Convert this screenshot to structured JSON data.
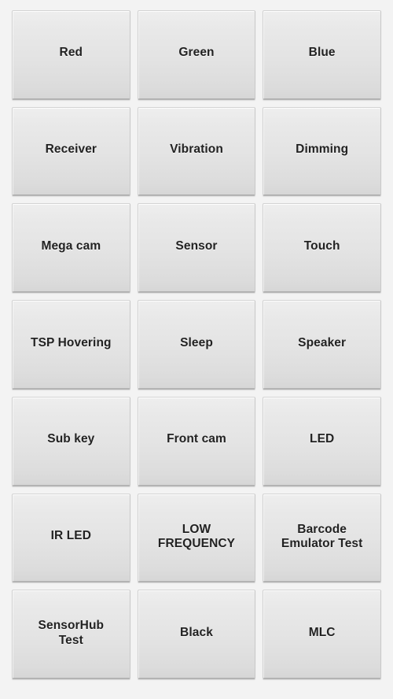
{
  "screen": {
    "name": "device-test-menu",
    "background_color": "#f3f3f3",
    "columns": 3,
    "rows": 7
  },
  "theme": {
    "button_face_top": "#eeeeee",
    "button_face_bottom": "#d6d6d6",
    "button_border": "#d3d3d3",
    "label_color": "#222222"
  },
  "buttons": [
    {
      "label": "Red"
    },
    {
      "label": "Green"
    },
    {
      "label": "Blue"
    },
    {
      "label": "Receiver"
    },
    {
      "label": "Vibration"
    },
    {
      "label": "Dimming"
    },
    {
      "label": "Mega cam"
    },
    {
      "label": "Sensor"
    },
    {
      "label": "Touch"
    },
    {
      "label": "TSP Hovering"
    },
    {
      "label": "Sleep"
    },
    {
      "label": "Speaker"
    },
    {
      "label": "Sub key"
    },
    {
      "label": "Front cam"
    },
    {
      "label": "LED"
    },
    {
      "label": "IR LED"
    },
    {
      "label": "LOW\nFREQUENCY"
    },
    {
      "label": "Barcode\nEmulator Test"
    },
    {
      "label": "SensorHub\nTest"
    },
    {
      "label": "Black"
    },
    {
      "label": "MLC"
    }
  ]
}
